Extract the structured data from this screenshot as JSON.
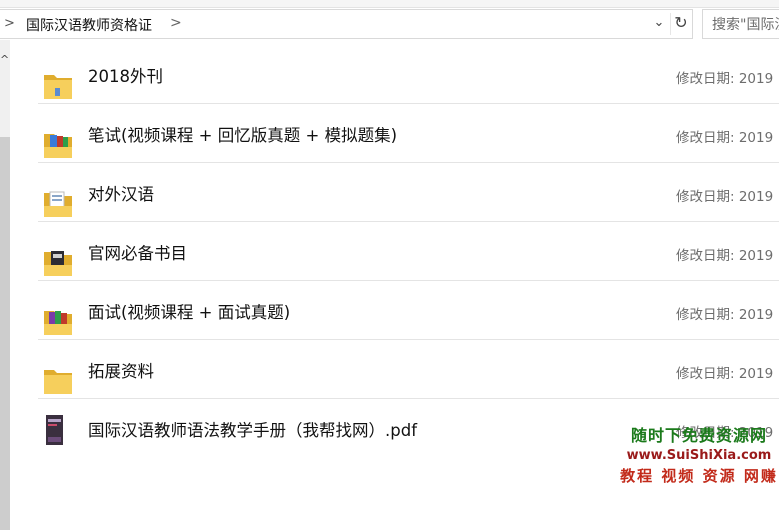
{
  "address_bar": {
    "path": "国际汉语教师资格证",
    "separator": ">",
    "back_chevron": ">"
  },
  "search": {
    "placeholder": "搜索\"国际汉语教师资格证\""
  },
  "files": [
    {
      "name": "2018外刊",
      "meta": "修改日期: 2019",
      "icon": "folder-icon"
    },
    {
      "name": "笔试(视频课程 + 回忆版真题 + 模拟题集)",
      "meta": "修改日期: 2019",
      "icon": "folder-with-files-icon"
    },
    {
      "name": "对外汉语",
      "meta": "修改日期: 2019",
      "icon": "folder-with-files-icon"
    },
    {
      "name": "官网必备书目",
      "meta": "修改日期: 2019",
      "icon": "folder-with-files-icon"
    },
    {
      "name": "面试(视频课程 + 面试真题)",
      "meta": "修改日期: 2019",
      "icon": "folder-with-files-icon"
    },
    {
      "name": "拓展资料",
      "meta": "修改日期: 2019",
      "icon": "folder-icon"
    },
    {
      "name": "国际汉语教师语法教学手册（我帮找网）.pdf",
      "meta": "修改日期: 2019",
      "icon": "pdf-book-icon"
    }
  ],
  "watermark": {
    "line1": "随时下免费资源网",
    "line2": "www.SuiShiXia.com",
    "line3": "教程 视频 资源 网赚"
  },
  "colors": {
    "folder": "#f2c94c",
    "folder_dark": "#e0ad2e",
    "watermark_green": "#1b7a1b",
    "watermark_red": "#c22a1a"
  }
}
